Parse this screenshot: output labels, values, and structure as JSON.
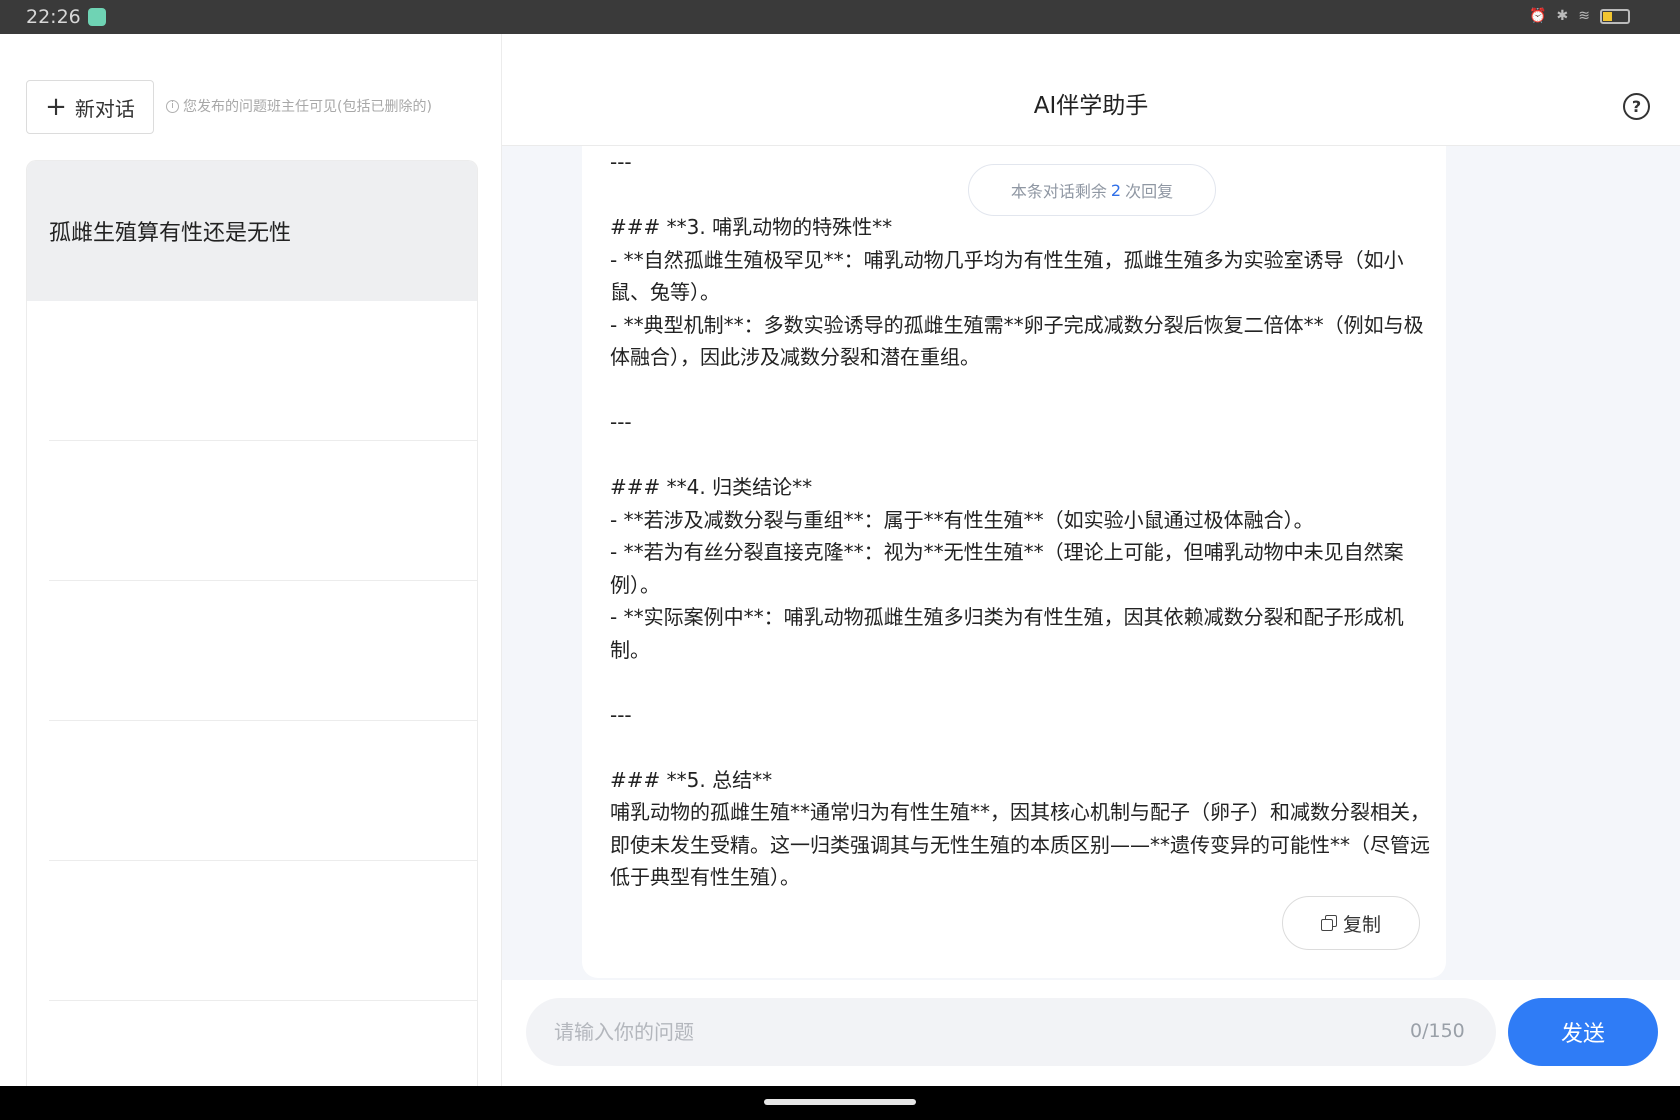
{
  "status_bar": {
    "time": "22:26"
  },
  "sidebar": {
    "new_chat_label": "新对话",
    "notice": "您发布的问题班主任可见(包括已删除的)",
    "history": [
      {
        "title": "孤雌生殖算有性还是无性",
        "active": true
      }
    ]
  },
  "header": {
    "title": "AI伴学助手"
  },
  "message": {
    "remaining_prefix": "本条对话剩余",
    "remaining_count": "2",
    "remaining_suffix": "次回复",
    "lines": [
      "---",
      "",
      "### **3. 哺乳动物的特殊性**",
      "- **自然孤雌生殖极罕见**：哺乳动物几乎均为有性生殖，孤雌生殖多为实验室诱导（如小鼠、兔等）。",
      "- **典型机制**：多数实验诱导的孤雌生殖需**卵子完成减数分裂后恢复二倍体**（例如与极体融合），因此涉及减数分裂和潜在重组。",
      "",
      "---",
      "",
      "### **4. 归类结论**",
      "- **若涉及减数分裂与重组**：属于**有性生殖**（如实验小鼠通过极体融合）。",
      "- **若为有丝分裂直接克隆**：视为**无性生殖**（理论上可能，但哺乳动物中未见自然案例）。",
      "- **实际案例中**：哺乳动物孤雌生殖多归类为有性生殖，因其依赖减数分裂和配子形成机制。",
      "",
      "---",
      "",
      "### **5. 总结**",
      "哺乳动物的孤雌生殖**通常归为有性生殖**，因其核心机制与配子（卵子）和减数分裂相关，即使未发生受精。这一归类强调其与无性生殖的本质区别——**遗传变异的可能性**（尽管远低于典型有性生殖）。"
    ],
    "copy_label": "复制"
  },
  "input": {
    "placeholder": "请输入你的问题",
    "value": "",
    "char_count": "0/150",
    "send_label": "发送"
  }
}
